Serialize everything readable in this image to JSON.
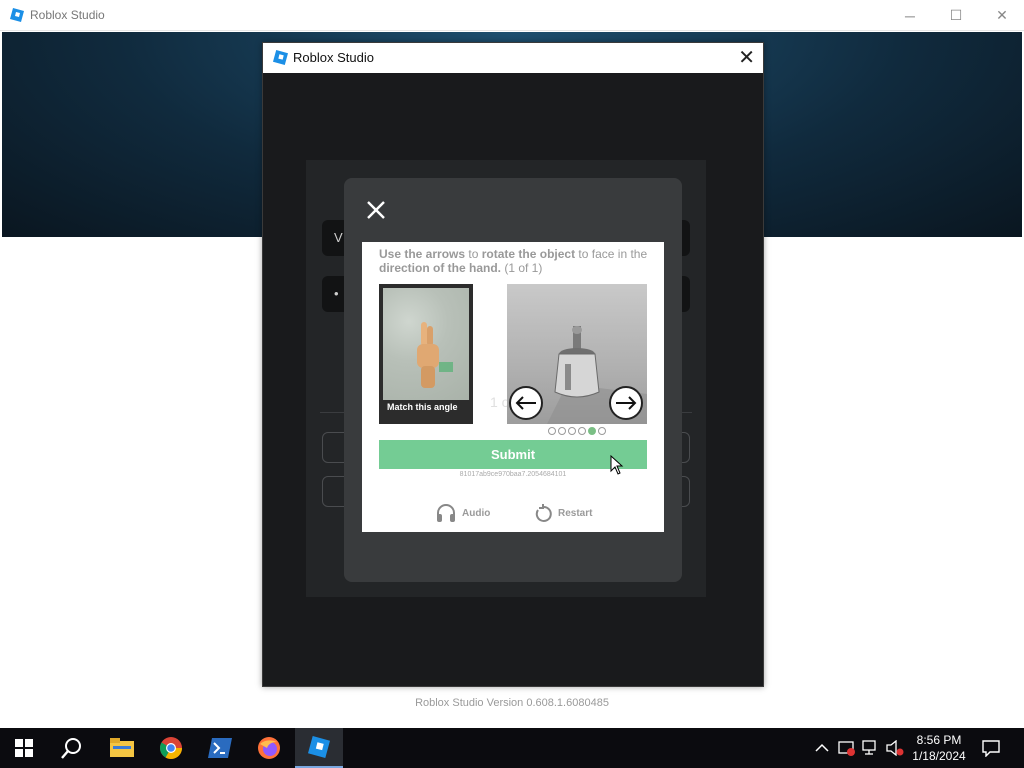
{
  "outer_window": {
    "title": "Roblox Studio",
    "controls": {
      "minimize": "─",
      "maximize": "☐",
      "close": "✕"
    }
  },
  "version_text": "Roblox Studio Version 0.608.1.6080485",
  "dialog": {
    "title": "Roblox Studio",
    "close": "✕"
  },
  "login_bg": {
    "field1_peek": "V",
    "field2_peek": "•",
    "counter_peek": "1 o"
  },
  "captcha": {
    "instructions": {
      "p1": "Use the arrows",
      "p2": " to ",
      "p3": "rotate the object",
      "p4": " to face in the ",
      "p5": "direction of the hand.",
      "p6": " (1 of 1)"
    },
    "reference_label": "Match this angle",
    "dots": [
      false,
      false,
      false,
      false,
      true,
      false
    ],
    "submit_label": "Submit",
    "session_id": "81017ab9ce970baa7.2054684101",
    "audio_label": "Audio",
    "restart_label": "Restart",
    "accent_color": "#74cc94"
  },
  "taskbar": {
    "items": [
      "start-icon",
      "search-icon",
      "file-explorer-icon",
      "chrome-icon",
      "powershell-icon",
      "firefox-icon",
      "roblox-studio-icon"
    ],
    "time": "8:56 PM",
    "date": "1/18/2024"
  }
}
